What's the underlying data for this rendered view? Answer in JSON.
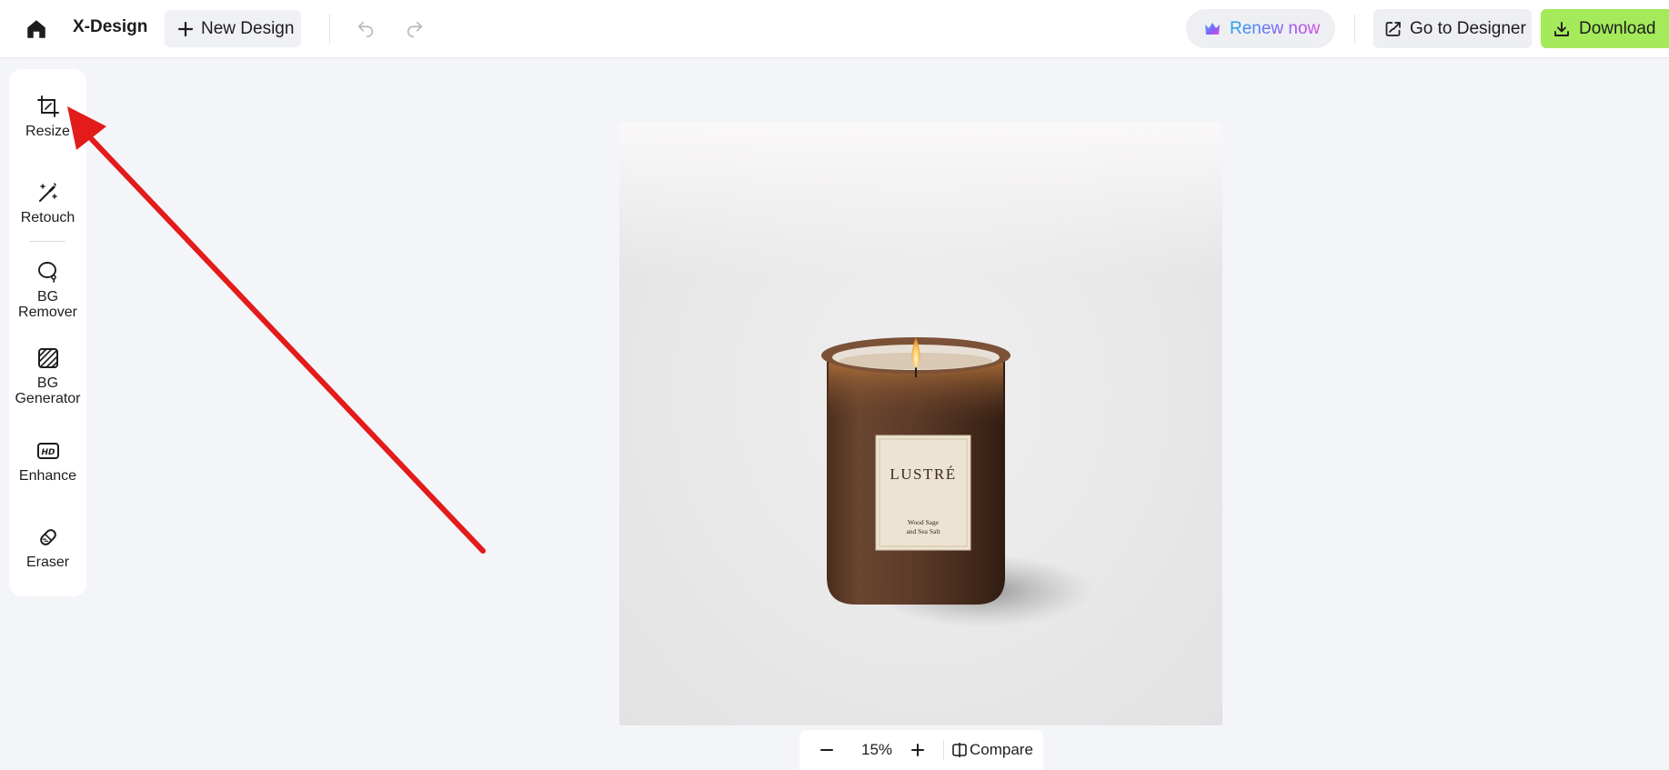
{
  "header": {
    "brand": "X-Design",
    "new_design_label": "New Design",
    "renew_label": "Renew now",
    "go_to_designer_label": "Go to Designer",
    "download_label": "Download"
  },
  "tools": [
    {
      "label": "Resize",
      "icon": "crop-resize-icon"
    },
    {
      "label": "Retouch",
      "icon": "magic-wand-icon"
    },
    {
      "label": "BG\nRemover",
      "icon": "lasso-icon"
    },
    {
      "label": "BG\nGenerator",
      "icon": "hatched-square-icon"
    },
    {
      "label": "Enhance",
      "icon": "hd-icon"
    },
    {
      "label": "Eraser",
      "icon": "eraser-icon"
    }
  ],
  "canvas": {
    "product_label_brand": "LUSTRÉ",
    "product_label_line1": "Wood Sage",
    "product_label_line2": "and Sea Salt"
  },
  "zoom": {
    "value": "15%",
    "compare_label": "Compare"
  },
  "colors": {
    "download_bg": "#a4ea5a",
    "annotation_arrow": "#e31b1b",
    "renew_gradient": [
      "#1da6f0",
      "#8d5cf6",
      "#d74be0"
    ]
  }
}
